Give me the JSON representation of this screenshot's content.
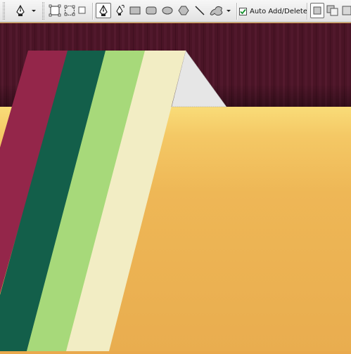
{
  "toolbar": {
    "tool_preset_icon": "pen-tool-icon",
    "mode_icons": [
      "shape-layers-icon",
      "paths-icon",
      "fill-pixels-icon"
    ],
    "shape_tools": [
      "pen-icon",
      "freeform-pen-icon",
      "rectangle-icon",
      "rounded-rectangle-icon",
      "ellipse-icon",
      "polygon-icon",
      "line-icon",
      "custom-shape-icon"
    ],
    "auto_add_delete": {
      "label": "Auto Add/Delete",
      "checked": true
    },
    "path_operations": [
      "add-to-path-area-icon",
      "subtract-from-path-area-icon"
    ]
  },
  "colors": {
    "wood_background": "#4a1426",
    "folder_light": "#f8d874",
    "folder_main": "#ebb352",
    "stripe_crimson": "#94264a",
    "stripe_green": "#135f4a",
    "stripe_lime": "#a7d97a",
    "stripe_cream": "#f2edc4",
    "paper_fold": "#e6e6e6",
    "checkbox_check": "#14922d"
  }
}
